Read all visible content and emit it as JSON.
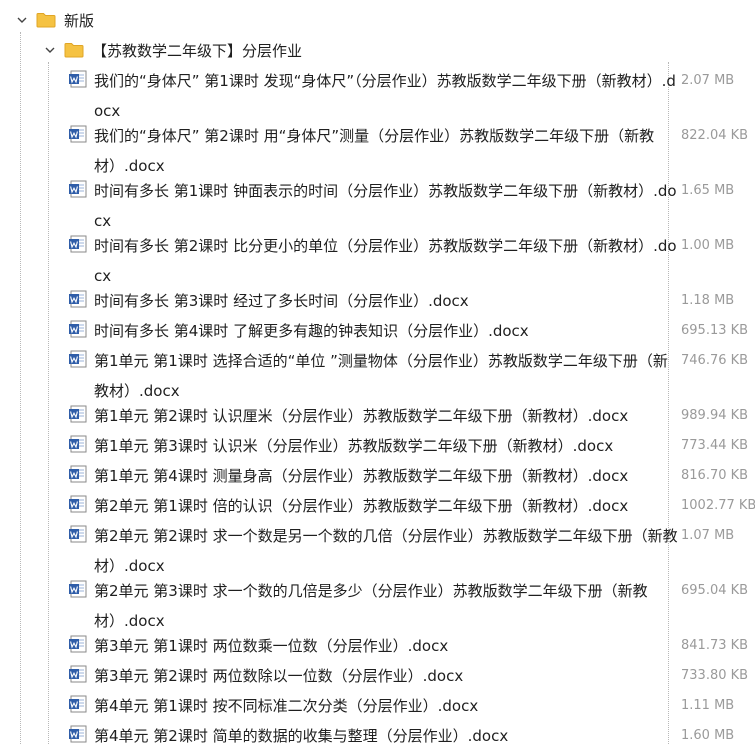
{
  "tree": {
    "root": {
      "label": "新版",
      "expanded": true
    },
    "subfolder": {
      "label": "【苏教数学二年级下】分层作业",
      "expanded": true
    },
    "files": [
      {
        "name": "我们的“身体尺” 第1课时 发现“身体尺”（分层作业）苏教版数学二年级下册（新教材）.docx",
        "size": "2.07 MB"
      },
      {
        "name": "我们的“身体尺” 第2课时 用“身体尺”测量（分层作业）苏教版数学二年级下册（新教材）.docx",
        "size": "822.04 KB"
      },
      {
        "name": "时间有多长 第1课时 钟面表示的时间（分层作业）苏教版数学二年级下册（新教材）.docx",
        "size": "1.65 MB"
      },
      {
        "name": "时间有多长 第2课时 比分更小的单位（分层作业）苏教版数学二年级下册（新教材）.docx",
        "size": "1.00 MB"
      },
      {
        "name": "时间有多长 第3课时 经过了多长时间（分层作业）.docx",
        "size": "1.18 MB"
      },
      {
        "name": "时间有多长 第4课时 了解更多有趣的钟表知识（分层作业）.docx",
        "size": "695.13 KB"
      },
      {
        "name": "第1单元 第1课时 选择合适的“单位 ”测量物体（分层作业）苏教版数学二年级下册（新教材）.docx",
        "size": "746.76 KB"
      },
      {
        "name": "第1单元 第2课时 认识厘米（分层作业）苏教版数学二年级下册（新教材）.docx",
        "size": "989.94 KB"
      },
      {
        "name": "第1单元 第3课时 认识米（分层作业）苏教版数学二年级下册（新教材）.docx",
        "size": "773.44 KB"
      },
      {
        "name": "第1单元 第4课时 测量身高（分层作业）苏教版数学二年级下册（新教材）.docx",
        "size": "816.70 KB"
      },
      {
        "name": "第2单元 第1课时 倍的认识（分层作业）苏教版数学二年级下册（新教材）.docx",
        "size": "1002.77 KB"
      },
      {
        "name": "第2单元 第2课时 求一个数是另一个数的几倍（分层作业）苏教版数学二年级下册（新教材）.docx",
        "size": "1.07 MB"
      },
      {
        "name": "第2单元 第3课时 求一个数的几倍是多少（分层作业）苏教版数学二年级下册（新教材）.docx",
        "size": "695.04 KB"
      },
      {
        "name": "第3单元 第1课时 两位数乘一位数（分层作业）.docx",
        "size": "841.73 KB"
      },
      {
        "name": "第3单元 第2课时 两位数除以一位数（分层作业）.docx",
        "size": "733.80 KB"
      },
      {
        "name": "第4单元 第1课时 按不同标准二次分类（分层作业）.docx",
        "size": "1.11 MB"
      },
      {
        "name": "第4单元 第2课时 简单的数据的收集与整理（分层作业）.docx",
        "size": "1.60 MB"
      }
    ]
  },
  "icons": {
    "chevron": "chevron-down-icon",
    "folder": "folder-icon",
    "file": "word-document-icon"
  },
  "colors": {
    "folder": "#f5c242",
    "folder_dark": "#e0a526",
    "word_blue": "#2f5da8",
    "size_text": "#9a9a9a"
  }
}
